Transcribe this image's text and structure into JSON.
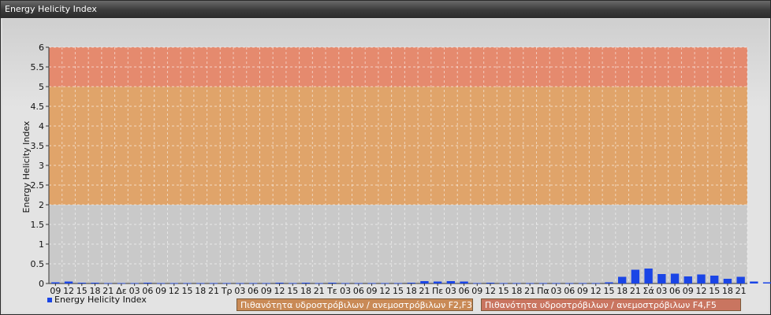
{
  "window": {
    "title": "Energy Helicity Index"
  },
  "chart_data": {
    "type": "bar",
    "title": "",
    "ylabel": "Energy Helicity Index",
    "xlabel": "",
    "ylim": [
      0,
      6
    ],
    "yticks": [
      "0",
      "0.5",
      "1",
      "1.5",
      "2",
      "2.5",
      "3",
      "3.5",
      "4",
      "4.5",
      "5",
      "5.5",
      "6"
    ],
    "grid": true,
    "categories": [
      "09",
      "12",
      "15",
      "18",
      "21",
      "Δε",
      "03",
      "06",
      "09",
      "12",
      "15",
      "18",
      "21",
      "Τρ",
      "03",
      "06",
      "09",
      "12",
      "15",
      "18",
      "21",
      "Τε",
      "03",
      "06",
      "09",
      "12",
      "15",
      "18",
      "21",
      "Πε",
      "03",
      "06",
      "09",
      "12",
      "15",
      "18",
      "21",
      "Πα",
      "03",
      "06",
      "09",
      "12",
      "15",
      "18",
      "21",
      "Σά",
      "03",
      "06",
      "09",
      "12",
      "15",
      "18",
      "21"
    ],
    "series": [
      {
        "name": "Energy Helicity Index",
        "color": "#1a45e6",
        "values": [
          0.03,
          0.05,
          0.02,
          0.02,
          0.01,
          0.01,
          0.01,
          0.02,
          0.01,
          0.01,
          0.01,
          0.01,
          0.01,
          0.01,
          0.01,
          0.01,
          0.01,
          0.02,
          0.01,
          0.02,
          0.01,
          0.02,
          0.01,
          0.01,
          0.01,
          0.01,
          0.01,
          0.02,
          0.06,
          0.05,
          0.06,
          0.05,
          0.01,
          0.02,
          0.01,
          0.01,
          0.01,
          0.01,
          0.01,
          0.01,
          0.01,
          0.01,
          0.03,
          0.17,
          0.35,
          0.38,
          0.24,
          0.25,
          0.18,
          0.23,
          0.2,
          0.12,
          0.17,
          0.05,
          0.03
        ]
      }
    ],
    "bands": [
      {
        "from": 0,
        "to": 2,
        "color": "#c9c9c9"
      },
      {
        "from": 2,
        "to": 5,
        "color": "#e0a46a"
      },
      {
        "from": 5,
        "to": 6,
        "color": "#e58a6e"
      }
    ],
    "legend": {
      "placement": "bottom",
      "series_label": "Energy Helicity Index",
      "band_labels": [
        {
          "label": "Πιθανότητα υδροστρόβιλων / ανεμοστρόβιλων F2,F3",
          "color": "#c98a56"
        },
        {
          "label": "Πιθανότητα υδροστρόβιλων / ανεμοστρόβιλων F4,F5",
          "color": "#c97560"
        }
      ]
    }
  }
}
